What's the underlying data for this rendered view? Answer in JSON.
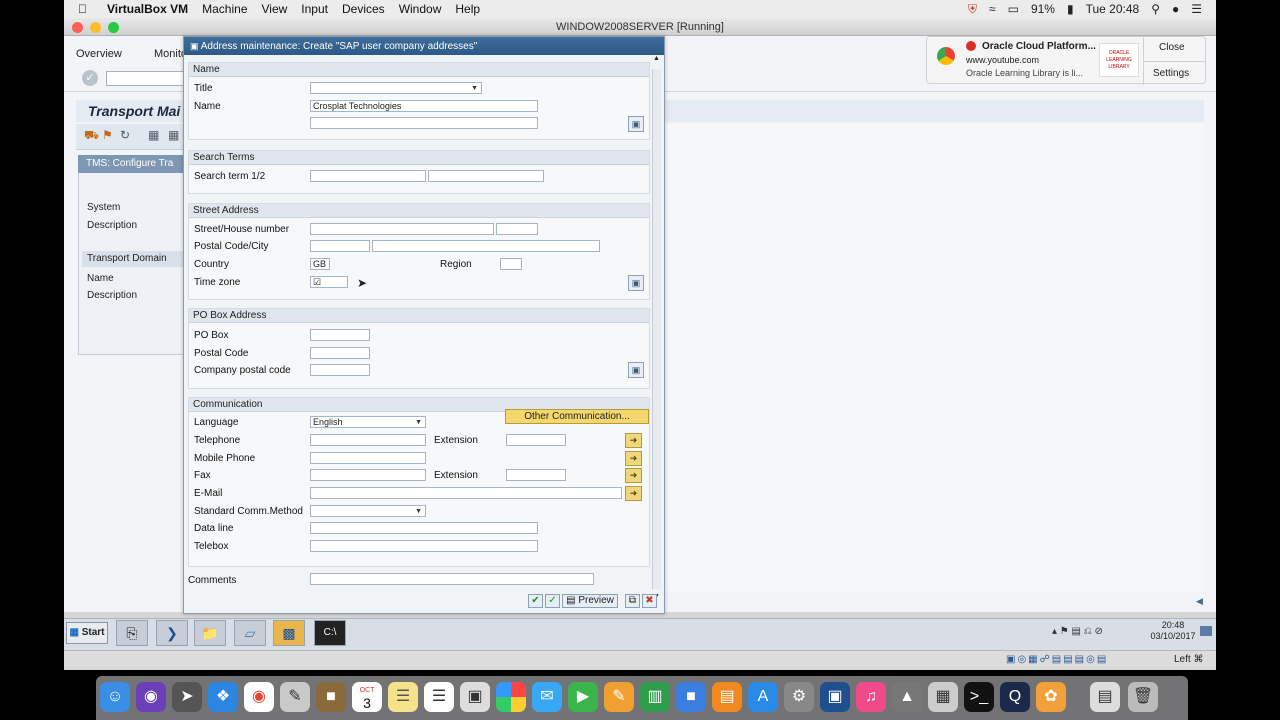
{
  "menubar": {
    "app": "VirtualBox VM",
    "items": [
      "Machine",
      "View",
      "Input",
      "Devices",
      "Window",
      "Help"
    ],
    "battery": "91%",
    "clock": "Tue 20:48"
  },
  "vbox": {
    "title": "WINDOW2008SERVER [Running]",
    "status_right": "Left ⌘"
  },
  "sap_bg": {
    "menu": [
      "Overview",
      "Monito"
    ],
    "title": "Transport Mai",
    "tms_head": "TMS: Configure Tra",
    "labels": [
      "System",
      "Description",
      "Transport Domain",
      "Name",
      "Description"
    ]
  },
  "dialog": {
    "title": "Address maintenance: Create \"SAP user company addresses\"",
    "name_group": {
      "head": "Name",
      "title_label": "Title",
      "name_label": "Name",
      "name_value": "Crosplat Technologies"
    },
    "search_group": {
      "head": "Search Terms",
      "label": "Search term 1/2"
    },
    "street_group": {
      "head": "Street Address",
      "street_label": "Street/House number",
      "postal_label": "Postal Code/City",
      "country_label": "Country",
      "country_value": "GB",
      "region_label": "Region",
      "tz_label": "Time zone"
    },
    "pobox_group": {
      "head": "PO Box Address",
      "pobox_label": "PO Box",
      "postal_label": "Postal Code",
      "company_label": "Company postal code"
    },
    "comm_group": {
      "head": "Communication",
      "language_label": "Language",
      "language_value": "English",
      "other_btn": "Other Communication...",
      "telephone_label": "Telephone",
      "extension_label": "Extension",
      "mobile_label": "Mobile Phone",
      "fax_label": "Fax",
      "fax_ext_label": "Extension",
      "email_label": "E-Mail",
      "std_label": "Standard Comm.Method",
      "dataline_label": "Data line",
      "telebox_label": "Telebox"
    },
    "comments_label": "Comments",
    "preview_btn": "Preview"
  },
  "notification": {
    "title": "Oracle Cloud Platform...",
    "site": "www.youtube.com",
    "body": "Oracle Learning Library is li...",
    "close": "Close",
    "settings": "Settings",
    "logo_text": "ORACLE LEARNING LIBRARY"
  },
  "taskbar": {
    "start": "Start",
    "clock_time": "20:48",
    "clock_date": "03/10/2017"
  },
  "dock": {
    "calendar_day": "3",
    "calendar_month": "OCT"
  }
}
